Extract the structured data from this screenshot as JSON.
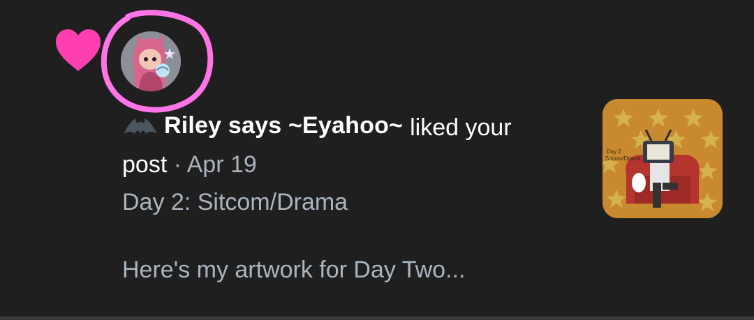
{
  "notification": {
    "user_name": "Riley says ~Eyahoo~",
    "action_part1": "liked your",
    "action_part2": "post",
    "separator": " · ",
    "date": "Apr 19",
    "post_title": "Day 2: Sitcom/Drama",
    "post_excerpt": "Here's my artwork for Day Two...",
    "thumbnail_caption": "Day 2\nSitcom/Drama"
  },
  "icons": {
    "like": "heart-icon",
    "badge": "bat-icon",
    "highlight": "hand-drawn-circle"
  },
  "colors": {
    "background": "#1f1f1f",
    "heart": "#ff3fb0",
    "highlight_circle": "#ff74e6",
    "primary_text": "#ffffff",
    "secondary_text": "#aab4bf",
    "thumbnail_bg": "#c98a2f"
  }
}
